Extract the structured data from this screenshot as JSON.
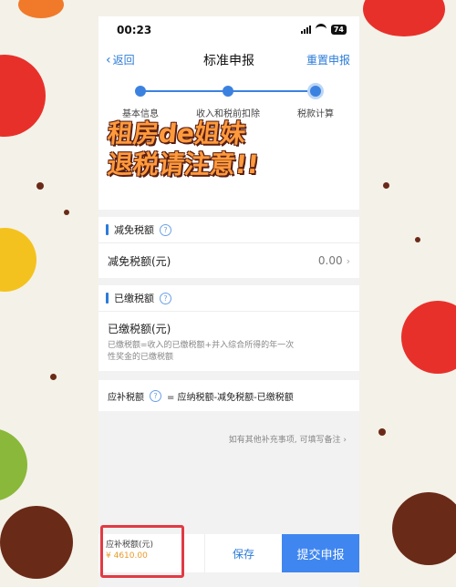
{
  "status": {
    "time": "00:23",
    "battery": "74"
  },
  "nav": {
    "back": "返回",
    "title": "标准申报",
    "reset": "重置申报"
  },
  "steps": [
    "基本信息",
    "收入和税前扣除",
    "税款计算"
  ],
  "overlay": {
    "line1": "租房de姐妹",
    "line2": "退税请注意!!"
  },
  "reduction": {
    "section": "减免税额",
    "row_label": "减免税额(元)",
    "row_value": "0.00"
  },
  "paid": {
    "section": "已缴税额",
    "label": "已缴税额(元)",
    "desc": "已缴税额=收入的已缴税额+并入综合所得的年一次性奖金的已缴税额"
  },
  "formula": {
    "label": "应补税额",
    "text": "= 应纳税额-减免税额-已缴税额"
  },
  "note": "如有其他补充事项, 可填写备注",
  "footer": {
    "due_label": "应补税额(元)",
    "due_value": "¥ 4610.00",
    "save": "保存",
    "submit": "提交申报"
  },
  "colors": {
    "accent": "#2b7bd8",
    "button": "#3f86f0",
    "highlight_box": "#e23a44",
    "amount": "#e99a2a",
    "overlay_text": "#ff9a3c"
  }
}
